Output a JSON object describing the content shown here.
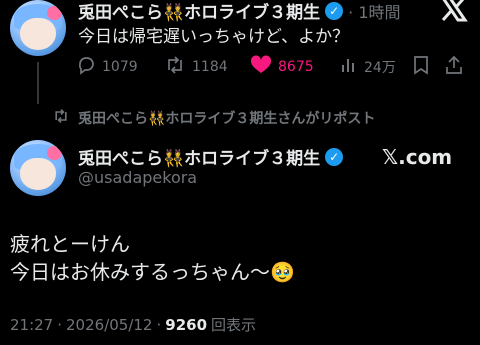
{
  "post1": {
    "author_name": "兎田ぺこら👯ホロライブ３期生",
    "timestamp": "· 1時間",
    "text": "今日は帰宅遅いっちゃけど、よか？",
    "stats": {
      "replies": "1079",
      "reposts": "1184",
      "likes": "8675",
      "views": "24万"
    }
  },
  "repost_banner": {
    "text": "兎田ぺこら👯ホロライブ３期生さんがリポスト"
  },
  "post2": {
    "author_name": "兎田ぺこら👯ホロライブ３期生",
    "handle": "@usadapekora",
    "text_line1": "疲れとーけん",
    "text_line2": "今日はお休みするっちゃん〜🥹",
    "time": "21:27",
    "date": "2026/05/12",
    "views_count": "9260",
    "views_label": "回表示",
    "brand": "𝕏.com"
  },
  "icons": {
    "x_logo": "x-logo",
    "verified": "verified-badge",
    "reply": "reply-icon",
    "repost": "repost-icon",
    "like": "heart-icon",
    "views": "views-icon",
    "bookmark": "bookmark-icon",
    "share": "share-icon"
  },
  "colors": {
    "background": "#000000",
    "text": "#e7e9ea",
    "muted": "#71767b",
    "verified": "#1d9bf0",
    "like": "#f91880"
  }
}
